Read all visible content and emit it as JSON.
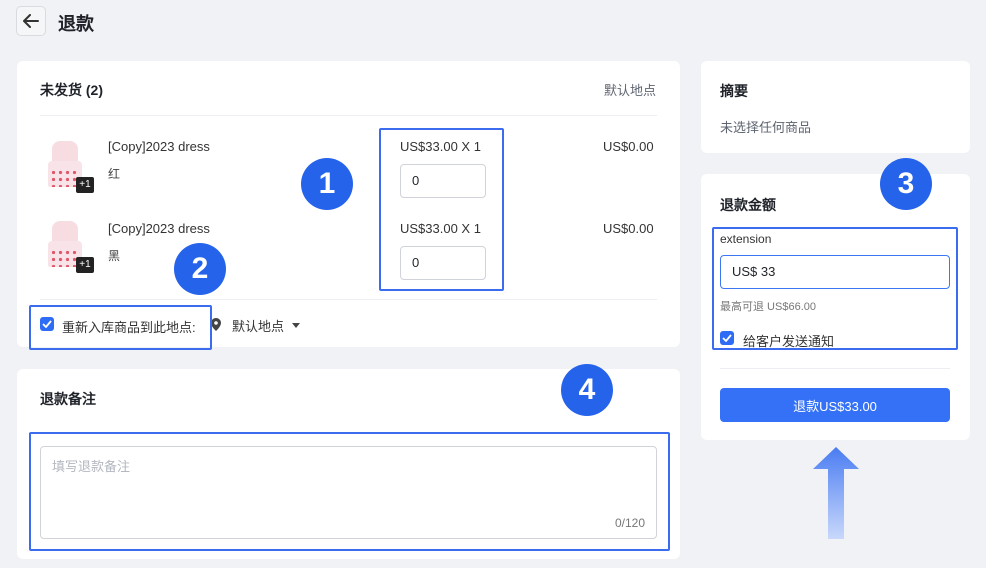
{
  "header": {
    "title": "退款"
  },
  "unshipped": {
    "title": "未发货 (2)",
    "location_label": "默认地点",
    "items": [
      {
        "name": "[Copy]2023 dress",
        "variant": "红",
        "price_qty": "US$33.00 X 1",
        "qty_value": "0",
        "total": "US$0.00",
        "badge": "+1"
      },
      {
        "name": "[Copy]2023 dress",
        "variant": "黑",
        "price_qty": "US$33.00 X 1",
        "qty_value": "0",
        "total": "US$0.00",
        "badge": "+1"
      }
    ],
    "restock_label": "重新入库商品到此地点:",
    "restock_location": "默认地点"
  },
  "notes": {
    "title": "退款备注",
    "placeholder": "填写退款备注",
    "counter": "0/120"
  },
  "summary": {
    "title": "摘要",
    "text": "未选择任何商品"
  },
  "refund": {
    "title": "退款金额",
    "method_label": "extension",
    "amount_value": "US$ 33",
    "max_hint": "最高可退 US$66.00",
    "notify_label": "给客户发送通知",
    "button_label": "退款US$33.00"
  },
  "annotations": [
    "1",
    "2",
    "3",
    "4"
  ],
  "colors": {
    "accent": "#2563eb",
    "highlight": "#3b6cf0",
    "button": "#3471f6"
  }
}
